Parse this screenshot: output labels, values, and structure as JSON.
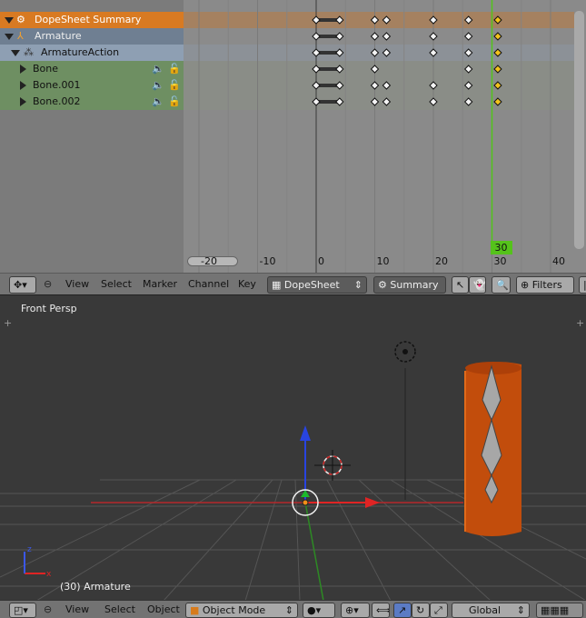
{
  "dopesheet": {
    "channels": [
      {
        "label": "DopeSheet Summary",
        "kind": "summary"
      },
      {
        "label": "Armature",
        "kind": "object"
      },
      {
        "label": "ArmatureAction",
        "kind": "action"
      },
      {
        "label": "Bone",
        "kind": "bone"
      },
      {
        "label": "Bone.001",
        "kind": "bone"
      },
      {
        "label": "Bone.002",
        "kind": "bone"
      }
    ],
    "frames_per_row": [
      [
        0,
        4,
        10,
        12,
        20,
        26,
        31
      ],
      [
        0,
        4,
        10,
        12,
        20,
        26,
        31
      ],
      [
        0,
        4,
        10,
        12,
        20,
        26,
        31
      ],
      [
        0,
        4,
        10,
        26,
        31
      ],
      [
        0,
        4,
        10,
        12,
        20,
        26,
        31
      ],
      [
        0,
        4,
        10,
        12,
        20,
        26,
        31
      ]
    ],
    "ruler_ticks": [
      "-20",
      "-10",
      "0",
      "10",
      "20",
      "30",
      "40"
    ],
    "tick_values": [
      -20,
      -10,
      0,
      10,
      20,
      30,
      40
    ],
    "current_frame": "30",
    "current_frame_value": 30,
    "header": {
      "menus": [
        "View",
        "Select",
        "Marker",
        "Channel",
        "Key"
      ],
      "mode": "DopeSheet",
      "summary": "Summary",
      "filters": "Filters"
    }
  },
  "viewport": {
    "view_label": "Front Persp",
    "object_label": "(30) Armature",
    "header": {
      "menus": [
        "View",
        "Select",
        "Object"
      ],
      "mode": "Object Mode",
      "orientation": "Global"
    }
  },
  "colors": {
    "summary_row": "#d87a22",
    "bone_row": "#6e8f62",
    "playhead": "#52c41a",
    "cylinder": "#c24d0c"
  }
}
